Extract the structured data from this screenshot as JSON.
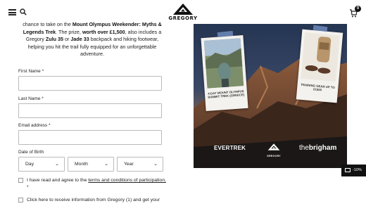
{
  "header": {
    "logo_text": "GREGORY",
    "cart_count": "0",
    "icons": [
      "menu-icon",
      "search-icon",
      "cart-icon"
    ]
  },
  "intro": {
    "line1_start": "chance to take on the ",
    "line1_bold": "Mount Olympus Weekender: Myths & Legends Trek",
    "line2_mid": ". The prize, ",
    "line2_bold": "worth over £1,500",
    "line2_end": ", also includes a Gregory ",
    "product1": "Zulu 35",
    "or": " or ",
    "product2": "Jade 33",
    "line3_end": " backpack and hiking footwear, helping you hit the trail fully equipped for an unforgettable adventure."
  },
  "form": {
    "first_name_label": "First Name *",
    "last_name_label": "Last Name *",
    "email_label": "Email address *",
    "dob_label": "Date of Birth",
    "day_label": "Day",
    "month_label": "Month",
    "year_label": "Year",
    "terms_prefix": "I have read and agree to the ",
    "terms_link": "terms and conditions of participation.",
    "terms_suffix": " *",
    "marketing_text": "Click here to receive information from Gregory (1) and get your"
  },
  "panel": {
    "polaroid1_caption": "4-DAY MOUNT OLYMPUS SUMMIT TREK (GREECE)",
    "polaroid2_caption": "TRAINING GEAR UP TO €1500",
    "brand_evertrek": "EVERTREK",
    "brand_gregory": "GREGORY",
    "brand_brigham_prefix": "the",
    "brand_brigham": "brigham"
  },
  "badge": {
    "text": "-10%"
  }
}
